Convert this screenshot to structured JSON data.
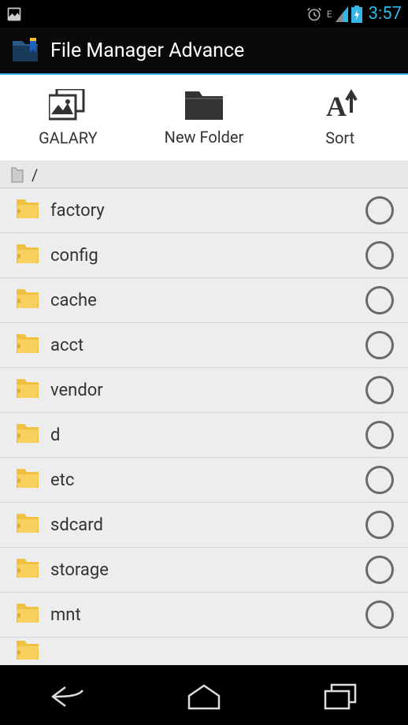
{
  "statusBar": {
    "time": "3:57",
    "network": "E"
  },
  "appBar": {
    "title": "File Manager Advance"
  },
  "toolbar": {
    "gallery": "GALARY",
    "newFolder": "New Folder",
    "sort": "Sort"
  },
  "path": {
    "current": "/"
  },
  "files": [
    {
      "name": "factory"
    },
    {
      "name": "config"
    },
    {
      "name": "cache"
    },
    {
      "name": "acct"
    },
    {
      "name": "vendor"
    },
    {
      "name": "d"
    },
    {
      "name": "etc"
    },
    {
      "name": "sdcard"
    },
    {
      "name": "storage"
    },
    {
      "name": "mnt"
    }
  ]
}
